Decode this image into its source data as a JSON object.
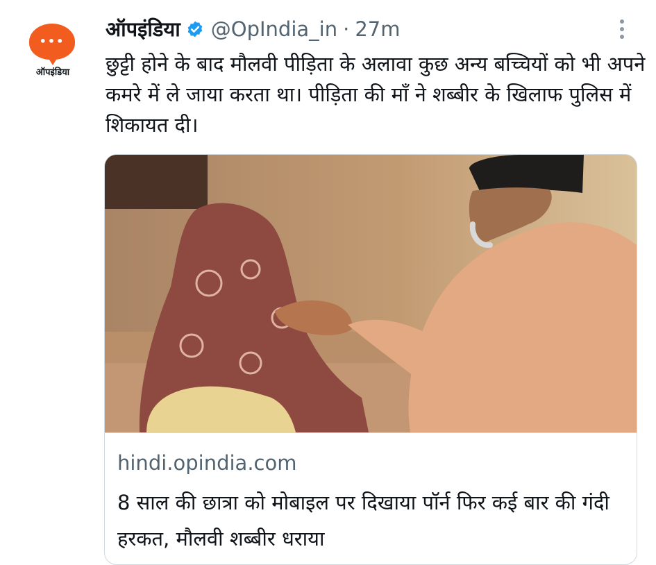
{
  "avatar": {
    "brand": "ऑपइंडिया",
    "dots": "•••"
  },
  "author": {
    "name": "ऑपइंडिया",
    "handle": "@OpIndia_in",
    "separator": "·",
    "time": "27m"
  },
  "tweet": {
    "text": "छुट्टी होने के बाद मौलवी पीड़िता के अलावा कुछ अन्य बच्चियों को भी अपने कमरे में ले जाया करता था। पीड़िता की माँ ने शब्बीर के खिलाफ पुलिस में शिकायत दी।"
  },
  "card": {
    "domain": "hindi.opindia.com",
    "headline": "8 साल की छात्रा को मोबाइल पर दिखाया पॉर्न फिर कई बार की गंदी हरकत, मौलवी शब्बीर धराया"
  },
  "colors": {
    "brand_orange": "#f25c1f",
    "verified_blue": "#1d9bf0",
    "muted": "#536471",
    "border": "#cfd9de"
  },
  "icons": [
    "verified-badge-icon",
    "more-options-icon"
  ]
}
